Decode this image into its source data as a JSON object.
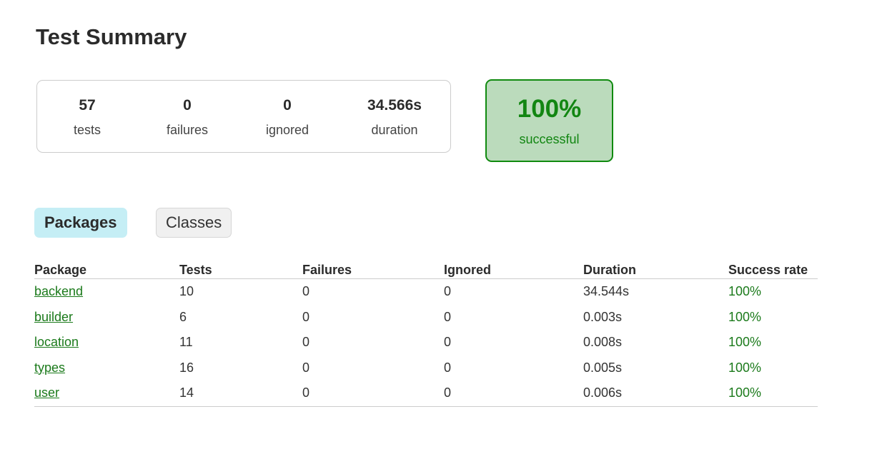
{
  "page": {
    "title": "Test Summary"
  },
  "summary": {
    "counters": [
      {
        "value": "57",
        "label": "tests"
      },
      {
        "value": "0",
        "label": "failures"
      },
      {
        "value": "0",
        "label": "ignored"
      },
      {
        "value": "34.566s",
        "label": "duration"
      }
    ],
    "success": {
      "value": "100%",
      "label": "successful",
      "color": "#108a0f"
    }
  },
  "tabs": [
    {
      "label": "Packages",
      "active": true
    },
    {
      "label": "Classes",
      "active": false
    }
  ],
  "table": {
    "headers": [
      "Package",
      "Tests",
      "Failures",
      "Ignored",
      "Duration",
      "Success rate"
    ],
    "rows": [
      {
        "package": "backend",
        "tests": "10",
        "failures": "0",
        "ignored": "0",
        "duration": "34.544s",
        "success_rate": "100%"
      },
      {
        "package": "builder",
        "tests": "6",
        "failures": "0",
        "ignored": "0",
        "duration": "0.003s",
        "success_rate": "100%"
      },
      {
        "package": "location",
        "tests": "11",
        "failures": "0",
        "ignored": "0",
        "duration": "0.008s",
        "success_rate": "100%"
      },
      {
        "package": "types",
        "tests": "16",
        "failures": "0",
        "ignored": "0",
        "duration": "0.005s",
        "success_rate": "100%"
      },
      {
        "package": "user",
        "tests": "14",
        "failures": "0",
        "ignored": "0",
        "duration": "0.006s",
        "success_rate": "100%"
      }
    ]
  }
}
